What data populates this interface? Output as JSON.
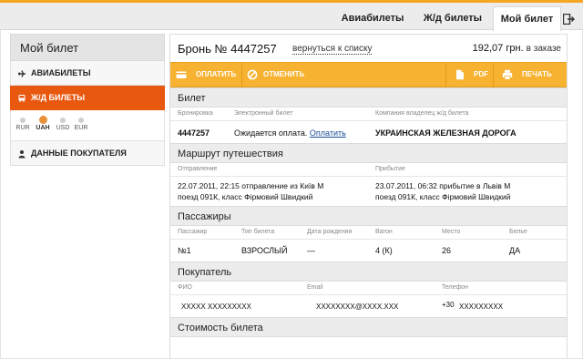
{
  "top_tabs": [
    {
      "label": "Авиабилеты"
    },
    {
      "label": "Ж/д билеты"
    },
    {
      "label": "Мой билет"
    }
  ],
  "sidebar": {
    "title": "Мой билет",
    "items": [
      {
        "label": "АВИАБИЛЕТЫ",
        "icon": "plane-icon"
      },
      {
        "label": "Ж/Д БИЛЕТЫ",
        "icon": "train-icon"
      },
      {
        "label": "ДАННЫЕ ПОКУПАТЕЛЯ",
        "icon": "user-icon"
      }
    ],
    "currencies": [
      {
        "code": "RUR",
        "selected": false
      },
      {
        "code": "UAH",
        "selected": true
      },
      {
        "code": "USD",
        "selected": false
      },
      {
        "code": "EUR",
        "selected": false
      }
    ]
  },
  "header": {
    "booking": "Бронь № 4447257",
    "back_link": "вернуться к списку",
    "price": "192,07 грн.",
    "price_status": "в заказе"
  },
  "actions": {
    "pay": "ОПЛАТИТЬ",
    "cancel": "ОТМЕНИТЬ",
    "pdf": "PDF",
    "print": "ПЕЧАТЬ"
  },
  "ticket": {
    "title": "Билет",
    "headers": {
      "booking": "Бронировка",
      "eticket": "Электронный билет",
      "company": "Компания владелец ж/д билета"
    },
    "booking": "4447257",
    "eticket_status": "Ожидается оплата.",
    "eticket_link": "Оплатить",
    "company": "УКРАИНСКАЯ ЖЕЛЕЗНАЯ ДОРОГА"
  },
  "route": {
    "title": "Маршрут путешествия",
    "headers": {
      "departure": "Отправление",
      "arrival": "Прибытие"
    },
    "departure_line1": "22.07.2011, 22:15 отправление из Київ М",
    "departure_line2": "поезд 091К, класс Фірмовий Швидкий",
    "arrival_line1": "23.07.2011, 06:32 прибытие в Львів М",
    "arrival_line2": "поезд 091К, класс Фірмовий Швидкий"
  },
  "passengers": {
    "title": "Пассажиры",
    "headers": [
      "Пассажир",
      "Тип билета",
      "Дата рождения",
      "Вагон",
      "Место",
      "Белье"
    ],
    "rows": [
      [
        "№1",
        "ВЗРОСЛЫЙ",
        "—",
        "4 (К)",
        "26",
        "ДА"
      ]
    ]
  },
  "buyer": {
    "title": "Покупатель",
    "headers": {
      "name": "ФИО",
      "email": "Email",
      "phone": "Телефон"
    },
    "name": "XXXXX XXXXXXXXX",
    "email": "XXXXXXXX@XXXX.XXX",
    "phone_code": "+30",
    "phone": "XXXXXXXXX"
  },
  "cost": {
    "title": "Стоимость билета"
  },
  "colors": {
    "accent": "#e8580f",
    "actionbar": "#f6b230",
    "link": "#1a4e9a"
  }
}
